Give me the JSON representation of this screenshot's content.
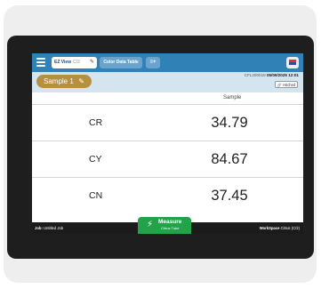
{
  "topbar": {
    "tab_active_label": "EZ View",
    "tab_active_page": "C/2",
    "tab_2_label": "Color Data Table",
    "tab_add_glyph": "≡+",
    "menu_icon": "hamburger-menu-icon",
    "flag_icon": "flag-icon"
  },
  "subbar": {
    "sample_label": "Sample 1",
    "device_id": "CFL200018",
    "datetime": "05/09/2025 12:01",
    "hitched_label": "Hitched"
  },
  "table": {
    "column_header": "Sample",
    "rows": [
      {
        "label": "CR",
        "value": "34.79"
      },
      {
        "label": "CY",
        "value": "84.67"
      },
      {
        "label": "CN",
        "value": "37.45"
      }
    ]
  },
  "bottombar": {
    "job_key": "Job:",
    "job_value": "Untitled Job",
    "workspace_key": "WorkSpace",
    "workspace_value": "Citrus (C/2)"
  },
  "measure": {
    "label": "Measure",
    "sublabel": "Citrus Tube",
    "icon": "bolt-icon"
  },
  "colors": {
    "topbar": "#2f81b6",
    "subbar": "#d4e5ef",
    "sample_pill": "#b7903f",
    "measure_button": "#22a34a"
  }
}
